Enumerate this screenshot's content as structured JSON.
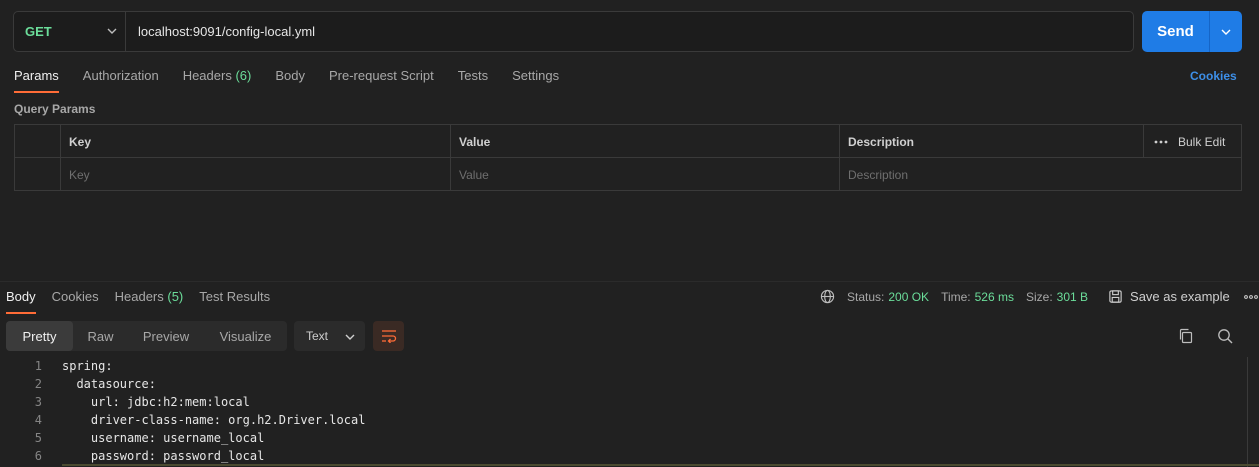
{
  "request": {
    "method": "GET",
    "url": "localhost:9091/config-local.yml",
    "send_label": "Send"
  },
  "request_tabs": [
    {
      "label": "Params",
      "count": ""
    },
    {
      "label": "Authorization",
      "count": ""
    },
    {
      "label": "Headers",
      "count": "(6)"
    },
    {
      "label": "Body",
      "count": ""
    },
    {
      "label": "Pre-request Script",
      "count": ""
    },
    {
      "label": "Tests",
      "count": ""
    },
    {
      "label": "Settings",
      "count": ""
    }
  ],
  "cookies_label": "Cookies",
  "query_params": {
    "title": "Query Params",
    "headers": {
      "key": "Key",
      "value": "Value",
      "description": "Description",
      "bulk_edit": "Bulk Edit"
    },
    "placeholders": {
      "key": "Key",
      "value": "Value",
      "description": "Description"
    }
  },
  "response_tabs": [
    {
      "label": "Body",
      "count": ""
    },
    {
      "label": "Cookies",
      "count": ""
    },
    {
      "label": "Headers",
      "count": "(5)"
    },
    {
      "label": "Test Results",
      "count": ""
    }
  ],
  "status": {
    "status_label": "Status:",
    "status_value": "200 OK",
    "time_label": "Time:",
    "time_value": "526 ms",
    "size_label": "Size:",
    "size_value": "301 B",
    "save_example": "Save as example"
  },
  "view_modes": [
    "Pretty",
    "Raw",
    "Preview",
    "Visualize"
  ],
  "format_select": "Text",
  "code_lines": [
    {
      "n": "1",
      "text": "spring:"
    },
    {
      "n": "2",
      "text": "  datasource:"
    },
    {
      "n": "3",
      "text": "    url: jdbc:h2:mem:local"
    },
    {
      "n": "4",
      "text": "    driver-class-name: org.h2.Driver.local"
    },
    {
      "n": "5",
      "text": "    username: username_local"
    },
    {
      "n": "6",
      "text": "    password: password_local"
    }
  ],
  "colors": {
    "accent_orange": "#ff6c37",
    "method_green": "#6bdd9a",
    "send_blue": "#1f7ce6",
    "link_blue": "#3d8fe8"
  }
}
